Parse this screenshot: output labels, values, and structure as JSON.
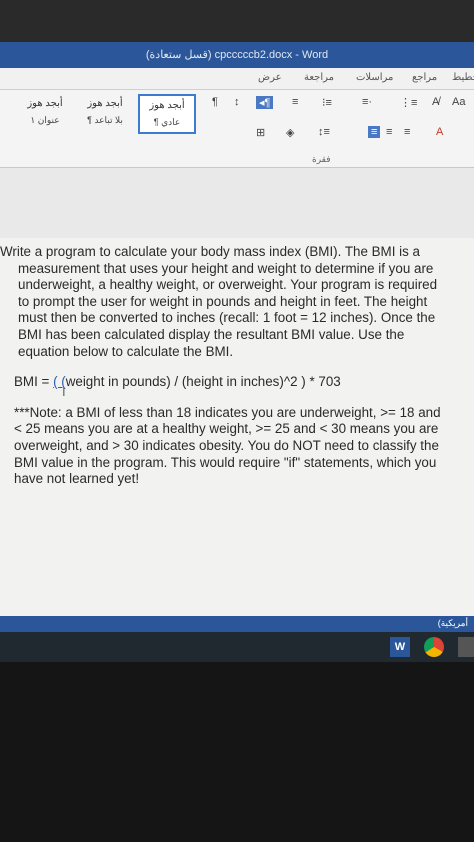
{
  "window": {
    "title": "(قسل ستعادة) cpcccccb2.docx - Word"
  },
  "tabs": [
    "عرض",
    "مراجعة",
    "مراسلات",
    "مراجع",
    "تخطيط"
  ],
  "ribbon": {
    "styles": [
      {
        "name": "أبجد هوز",
        "label": "¶ عادي"
      },
      {
        "name": "أبجد هوز",
        "label": "¶ بلا تباعد"
      },
      {
        "name": "أبجد هوز",
        "label": "عنوان ١"
      }
    ],
    "paragraph_group": "فقرة",
    "font_group_labels": [
      "Aa",
      "A"
    ]
  },
  "document": {
    "paragraph1": "Write a program to calculate your body mass index (BMI). The BMI is a measurement that uses your height and weight to determine if you are underweight, a healthy weight, or overweight. Your program is required to prompt the user for weight in pounds and height in feet. The height must then be converted to inches (recall: 1 foot = 12 inches). Once the BMI has been calculated display the resultant BMI value. Use the equation below to calculate the BMI.",
    "formula_prefix": "BMI = ",
    "formula_paren": "( (",
    "formula_rest": "weight in pounds) / (height in inches)^2 ) * 703",
    "note": "***Note: a BMI of less than 18 indicates you are underweight, >= 18 and < 25 means you are at a healthy weight, >= 25 and < 30 means you are overweight, and > 30 indicates obesity. You do NOT need to classify the BMI value in the program. This would require \"if\" statements, which you have not learned yet!"
  },
  "statusbar": {
    "language": "(أمريكية"
  },
  "taskbar": {
    "icons": [
      "word-icon",
      "chrome-icon",
      "app-icon"
    ]
  },
  "colors": {
    "word_blue": "#2b579a",
    "accent_select": "#3c7bd0"
  }
}
